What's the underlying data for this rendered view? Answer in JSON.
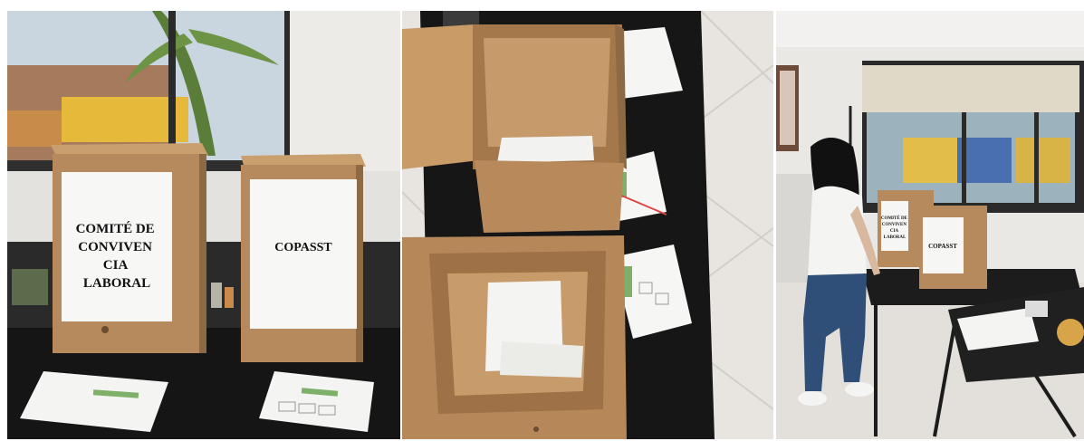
{
  "panels": [
    {
      "box_left": {
        "lines": [
          "COMITÉ DE",
          "CONVIVEN",
          "CIA",
          "LABORAL"
        ]
      },
      "box_right": {
        "label": "COPASST"
      }
    },
    {},
    {
      "box_left": {
        "lines": [
          "COMITÉ DE",
          "CONVIVEN",
          "CIA",
          "LABORAL"
        ]
      },
      "box_right": {
        "label": "COPASST"
      }
    }
  ],
  "colors": {
    "cardboard": "#b58a5c",
    "cardboard_dark": "#8e6841",
    "cardboard_light": "#d0a675",
    "desk": "#1a1a1a",
    "floor": "#e9e6e2",
    "wall": "#eceae8",
    "paper": "#f7f7f5",
    "accent_green": "#7fb069"
  }
}
